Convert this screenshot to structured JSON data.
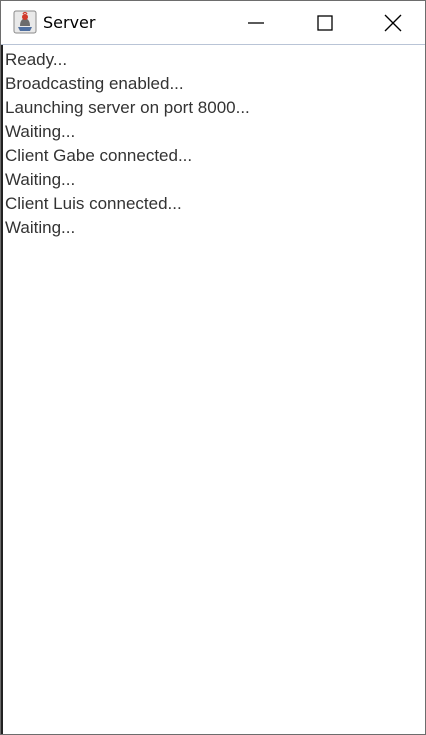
{
  "window": {
    "title": "Server",
    "icon": "java-coffee-cup-icon",
    "controls": [
      "minimize-icon",
      "maximize-icon",
      "close-icon"
    ]
  },
  "log": {
    "lines": [
      "Ready...",
      "Broadcasting enabled...",
      "Launching server on port 8000...",
      "Waiting...",
      "Client Gabe connected...",
      "Waiting...",
      "Client Luis connected...",
      "Waiting..."
    ]
  }
}
